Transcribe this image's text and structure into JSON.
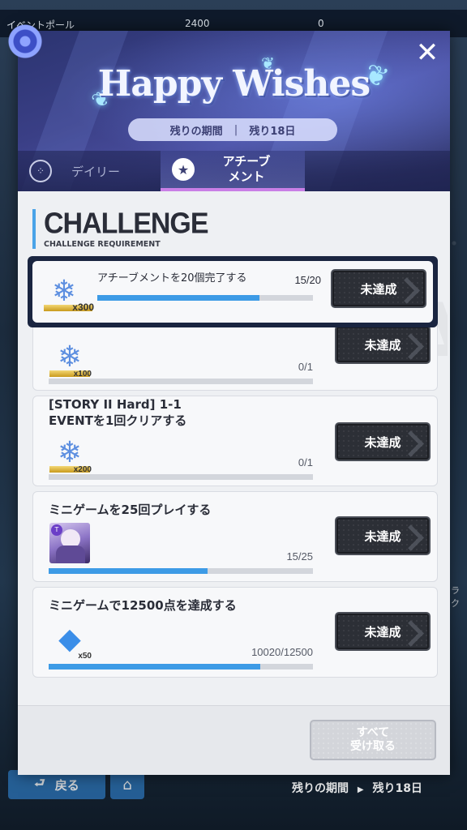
{
  "background": {
    "topbar_left": "イベントポール",
    "topbar_mid": "2400",
    "topbar_right": "0",
    "back_label": "戻る",
    "remaining_label": "残りの期間",
    "remaining_value": "残り18日",
    "side_label": "ラク"
  },
  "banner": {
    "title": "Happy Wishes",
    "period_label": "残りの期間",
    "period_value": "残り18日"
  },
  "tabs": [
    {
      "label": "デイリー",
      "active": false
    },
    {
      "label": "アチーブ\nメント",
      "active": true
    }
  ],
  "section": {
    "title": "CHALLENGE",
    "subtitle": "CHALLENGE REQUIREMENT",
    "watermark": "REWARD"
  },
  "missions": [
    {
      "title": "アチーブメントを20個完了する",
      "reward_icon": "snowflake-icon",
      "reward_qty": "x300",
      "progress_text": "15/20",
      "progress": 0.75,
      "status": "未達成",
      "highlighted": true
    },
    {
      "title": "",
      "reward_icon": "snowflake-icon",
      "reward_qty": "x100",
      "progress_text": "0/1",
      "progress": 0,
      "status": "未達成"
    },
    {
      "title_line1": "[STORY II Hard] 1-1",
      "title_line2": "EVENTを1回クリアする",
      "reward_icon": "snowflake-icon",
      "reward_qty": "x200",
      "progress_text": "0/1",
      "progress": 0,
      "status": "未達成"
    },
    {
      "title": "ミニゲームを25回プレイする",
      "reward_icon": "character-portrait-icon",
      "reward_qty": "",
      "progress_text": "15/25",
      "progress": 0.6,
      "status": "未達成"
    },
    {
      "title": "ミニゲームで12500点を達成する",
      "reward_icon": "blue-crystal-icon",
      "reward_qty": "x50",
      "progress_text": "10020/12500",
      "progress": 0.8016,
      "status": "未達成"
    }
  ],
  "footer": {
    "claim_all_line1": "すべて",
    "claim_all_line2": "受け取る"
  },
  "colors": {
    "progress": "#3d9be6",
    "status_button": "#2c2f36",
    "accent": "#4aa3e8"
  }
}
